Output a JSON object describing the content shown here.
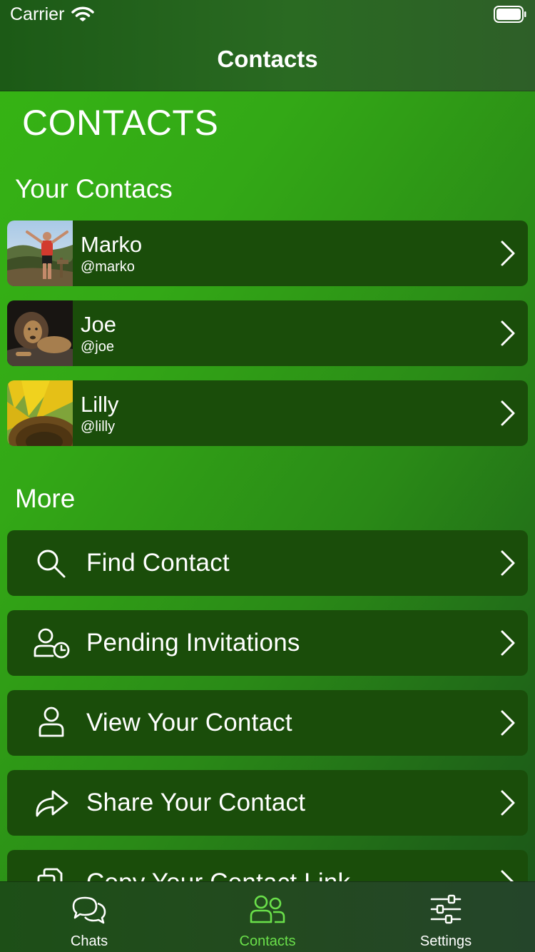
{
  "status_bar": {
    "carrier": "Carrier"
  },
  "nav": {
    "title": "Contacts"
  },
  "page": {
    "heading": "CONTACTS"
  },
  "contacts_section": {
    "title": "Your Contacs"
  },
  "contacts": [
    {
      "name": "Marko",
      "handle": "@marko",
      "avatar": "man-on-mountain-photo"
    },
    {
      "name": "Joe",
      "handle": "@joe",
      "avatar": "lion-photo"
    },
    {
      "name": "Lilly",
      "handle": "@lilly",
      "avatar": "sunflower-photo"
    }
  ],
  "more_section": {
    "title": "More"
  },
  "more_items": [
    {
      "label": "Find Contact",
      "icon": "search-icon"
    },
    {
      "label": "Pending Invitations",
      "icon": "user-clock-icon"
    },
    {
      "label": "View Your Contact",
      "icon": "user-icon"
    },
    {
      "label": "Share Your Contact",
      "icon": "share-arrow-icon"
    },
    {
      "label": "Copy Your Contact Link",
      "icon": "copy-icon"
    }
  ],
  "tabbar": {
    "tabs": [
      {
        "label": "Chats",
        "icon": "chat-bubbles-icon",
        "active": false
      },
      {
        "label": "Contacts",
        "icon": "people-icon",
        "active": true
      },
      {
        "label": "Settings",
        "icon": "sliders-icon",
        "active": false
      }
    ]
  },
  "colors": {
    "accent": "#6ae04a",
    "row_background": "#1a4d0a",
    "gradient_start": "#36b514",
    "gradient_end": "#1b5319"
  }
}
